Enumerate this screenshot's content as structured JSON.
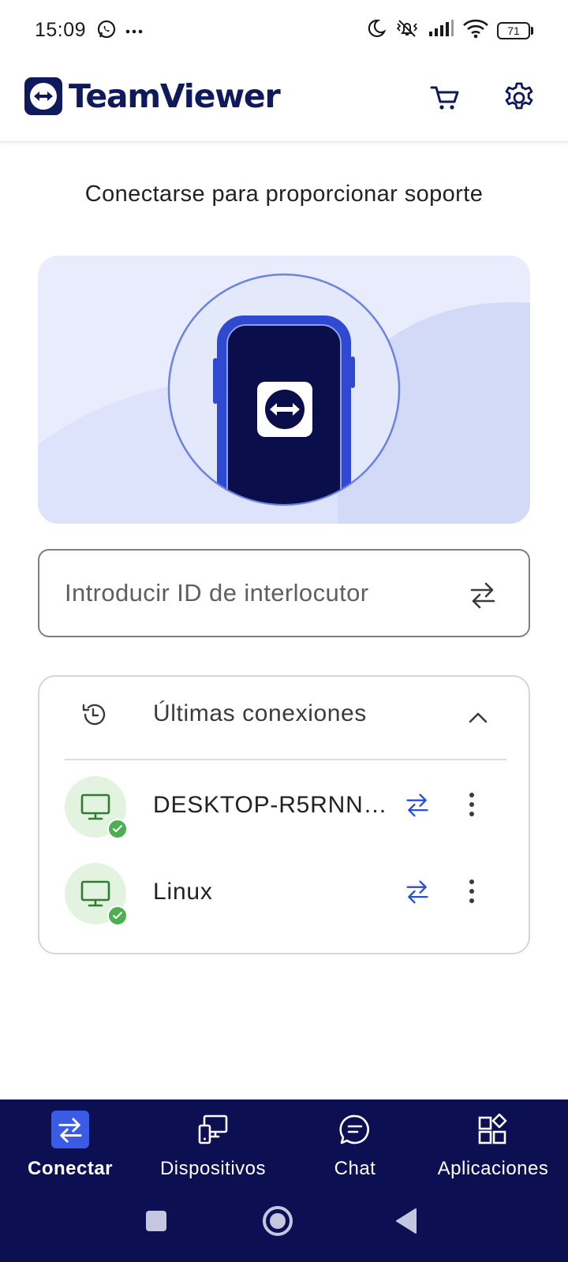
{
  "status_bar": {
    "time": "15:09",
    "left_icons": [
      "whatsapp-icon",
      "more-notifications-icon"
    ],
    "right_icons": [
      "do-not-disturb-moon-icon",
      "mute-vibrate-icon",
      "cell-signal-icon",
      "wifi-icon",
      "battery-icon"
    ],
    "battery_level": "71"
  },
  "header": {
    "app_name": "TeamViewer",
    "cart_icon": "cart-icon",
    "settings_icon": "gear-icon"
  },
  "main": {
    "title": "Conectarse para proporcionar soporte",
    "partner_id_placeholder": "Introducir ID de interlocutor",
    "recent": {
      "title": "Últimas conexiones",
      "expanded": true,
      "items": [
        {
          "name": "DESKTOP-R5RNN…",
          "online": true
        },
        {
          "name": "Linux",
          "online": true
        }
      ]
    }
  },
  "bottom_nav": {
    "items": [
      {
        "label": "Conectar",
        "icon": "connect-arrows-icon",
        "active": true
      },
      {
        "label": "Dispositivos",
        "icon": "devices-icon",
        "active": false
      },
      {
        "label": "Chat",
        "icon": "chat-bubble-icon",
        "active": false
      },
      {
        "label": "Aplicaciones",
        "icon": "apps-grid-icon",
        "active": false
      }
    ]
  },
  "system_nav": [
    "recents-square-icon",
    "home-circle-icon",
    "back-triangle-icon"
  ],
  "colors": {
    "brand_navy": "#0e1a5b",
    "nav_background": "#0c0f52",
    "accent_blue": "#2a4fd6",
    "online_green": "#4caf50",
    "hero_background": "#e8ecfc"
  }
}
